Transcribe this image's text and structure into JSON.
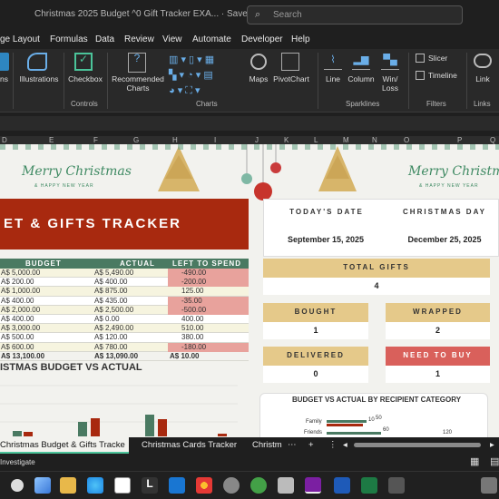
{
  "window": {
    "title": "Christmas 2025 Budget ^0 Gift Tracker EXA...",
    "saved": "Saved",
    "search_placeholder": "Search"
  },
  "menu": [
    "ge Layout",
    "Formulas",
    "Data",
    "Review",
    "View",
    "Automate",
    "Developer",
    "Help"
  ],
  "ribbon": {
    "illustrations": "Illustrations",
    "checkbox": "Checkbox",
    "recommended_charts": "Recommended Charts",
    "maps": "Maps",
    "pivotchart": "PivotChart",
    "line": "Line",
    "column": "Column",
    "winloss": "Win/ Loss",
    "slicer": "Slicer",
    "timeline": "Timeline",
    "link": "Link",
    "group_controls": "Controls",
    "group_charts": "Charts",
    "group_sparklines": "Sparklines",
    "group_filters": "Filters",
    "group_links": "Links",
    "cut_label": "ns"
  },
  "columns": [
    "D",
    "E",
    "F",
    "G",
    "H",
    "I",
    "J",
    "K",
    "L",
    "M",
    "N",
    "O",
    "P",
    "Q"
  ],
  "sheet": {
    "banner": "ET & GIFTS TRACKER",
    "merry": "Merry Christmas",
    "merry_sub": "& HAPPY NEW YEAR",
    "headers": [
      "BUDGET",
      "ACTUAL",
      "LEFT TO SPEND"
    ],
    "rows": [
      [
        "A$ 5,000.00",
        "A$ 5,490.00",
        "-490.00"
      ],
      [
        "A$ 200.00",
        "A$ 400.00",
        "-200.00"
      ],
      [
        "A$ 1,000.00",
        "A$ 875.00",
        "125.00"
      ],
      [
        "A$ 400.00",
        "A$ 435.00",
        "-35.00"
      ],
      [
        "A$ 2,000.00",
        "A$ 2,500.00",
        "-500.00"
      ],
      [
        "A$ 400.00",
        "A$ 0.00",
        "400.00"
      ],
      [
        "A$ 3,000.00",
        "A$ 2,490.00",
        "510.00"
      ],
      [
        "A$ 500.00",
        "A$ 120.00",
        "380.00"
      ],
      [
        "A$ 600.00",
        "A$ 780.00",
        "-180.00"
      ]
    ],
    "total": [
      "A$ 13,100.00",
      "A$ 13,090.00",
      "A$ 10.00"
    ],
    "chart_title": "ISTMAS BUDGET VS ACTUAL",
    "todays_date_label": "TODAY'S DATE",
    "todays_date": "September 15, 2025",
    "christmas_day_label": "CHRISTMAS DAY",
    "christmas_day": "December 25, 2025",
    "total_gifts_label": "TOTAL GIFTS",
    "total_gifts": "4",
    "bought_label": "BOUGHT",
    "bought": "1",
    "wrapped_label": "WRAPPED",
    "wrapped": "2",
    "delivered_label": "DELIVERED",
    "delivered": "0",
    "need_label": "NEED TO BUY",
    "need": "1",
    "recip_chart_title": "BUDGET VS ACTUAL BY RECIPIENT CATEGORY",
    "recip_family": "Family",
    "recip_friends": "Friends",
    "recip_v1": "50",
    "recip_v2": "60",
    "recip_v3": "120",
    "recip_v4": "10"
  },
  "tabs": [
    "Christmas Budget & Gifts Tracke",
    "Christmas Cards Tracker",
    "Christm",
    "+"
  ],
  "status": {
    "text": "Investigate"
  },
  "colors": {
    "red": "#a8290f",
    "green": "#4a7a62",
    "gold": "#e5c98a",
    "need": "#d9605b"
  }
}
